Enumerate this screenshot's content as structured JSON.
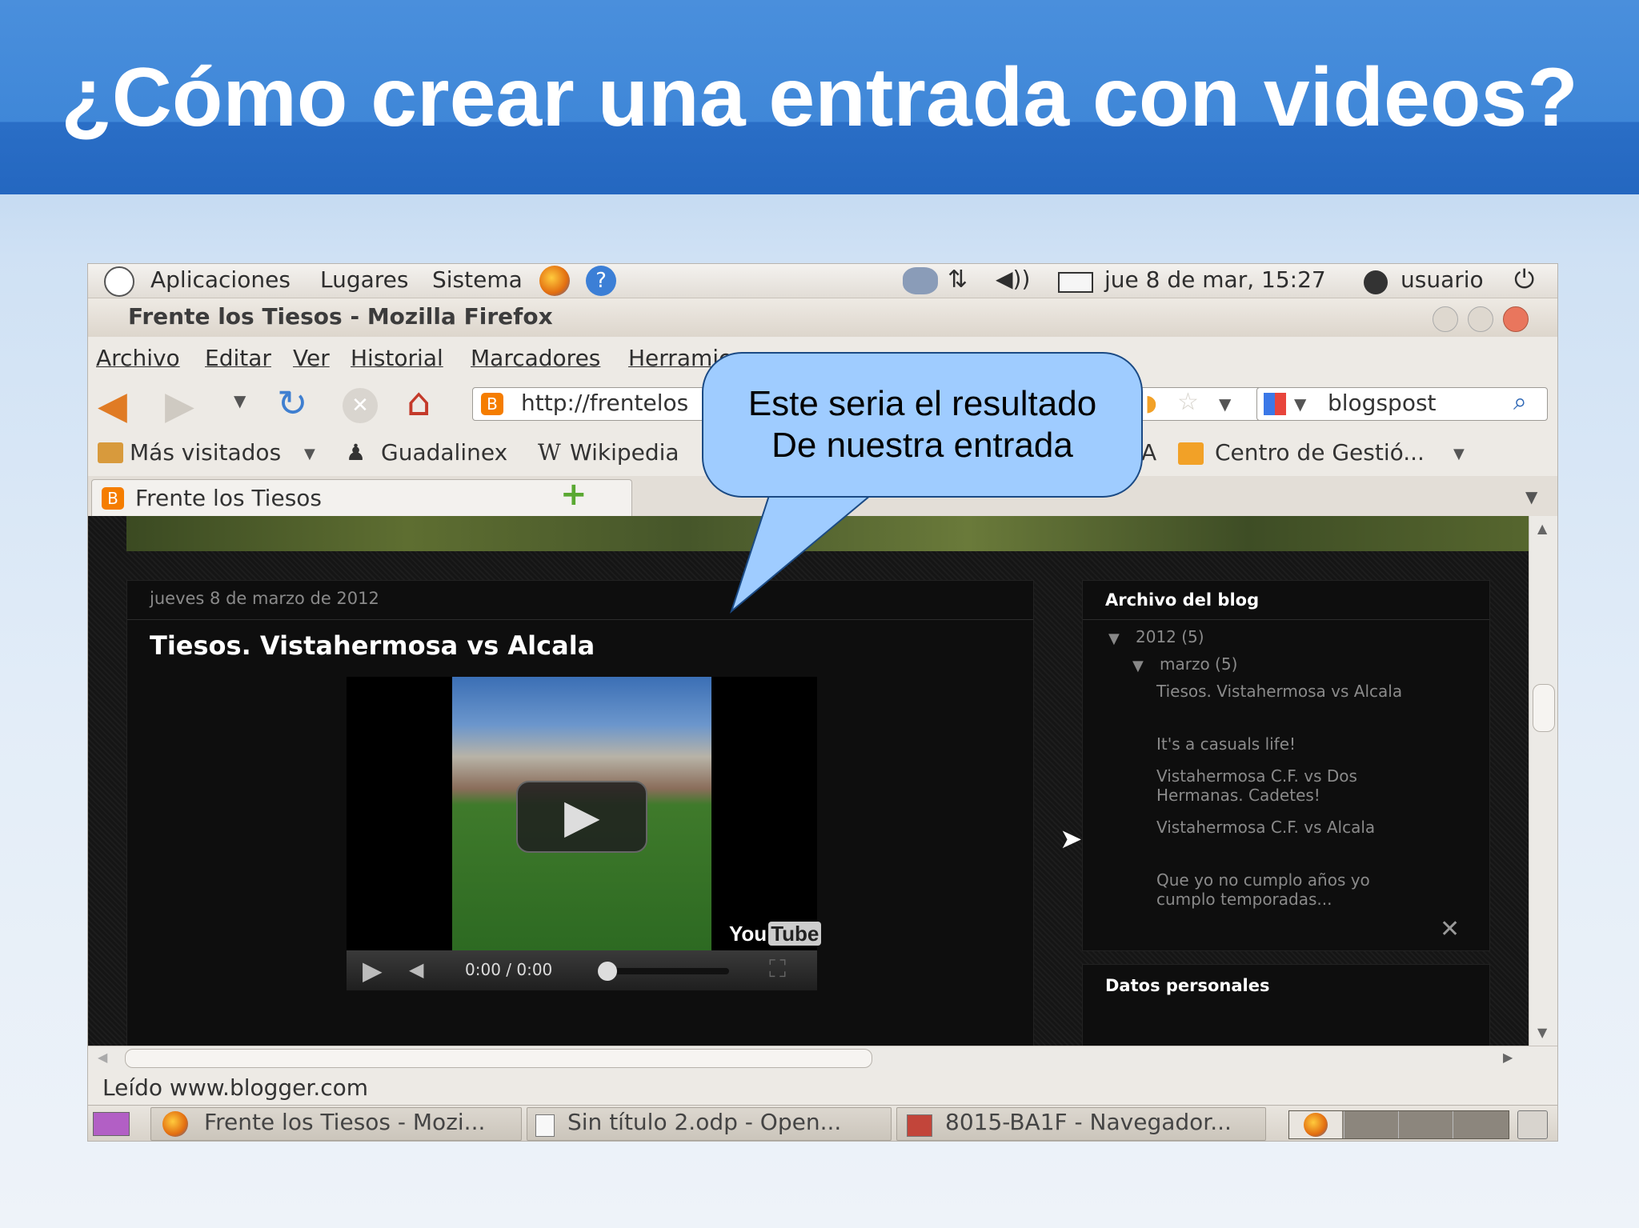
{
  "slide": {
    "title": "¿Cómo crear una entrada con videos?"
  },
  "callout": {
    "line1": "Este seria el resultado",
    "line2": "De nuestra entrada"
  },
  "gnome_panel": {
    "menus": [
      "Aplicaciones",
      "Lugares",
      "Sistema"
    ],
    "clock": "jue  8 de mar, 15:27",
    "user": "usuario"
  },
  "window": {
    "title": "Frente los Tiesos - Mozilla Firefox"
  },
  "menubar": [
    "Archivo",
    "Editar",
    "Ver",
    "Historial",
    "Marcadores",
    "Herramie"
  ],
  "navbar": {
    "url": "http://frentelos",
    "search_value": "blogspost"
  },
  "bookmarks": {
    "items": [
      "Más visitados",
      "Guadalinex",
      "Wikipedia"
    ],
    "partial": "A",
    "right_item": "Centro de Gestió..."
  },
  "tabs": [
    {
      "label": "Frente los Tiesos"
    }
  ],
  "post": {
    "date": "jueves 8 de marzo de 2012",
    "title": "Tiesos. Vistahermosa vs Alcala",
    "video": {
      "time": "0:00 / 0:00",
      "brand_you": "You",
      "brand_tube": "Tube"
    }
  },
  "sidebar": {
    "archive_title": "Archivo del blog",
    "year": "2012 (5)",
    "month": "marzo (5)",
    "posts": [
      "Tiesos. Vistahermosa vs Alcala",
      "It's a casuals life!",
      "Vistahermosa C.F. vs Dos Hermanas. Cadetes!",
      "Vistahermosa C.F. vs Alcala",
      "Que yo no cumplo años yo cumplo temporadas..."
    ],
    "personal_title": "Datos personales"
  },
  "status": {
    "text": "Leído www.blogger.com"
  },
  "taskbar": {
    "items": [
      "Frente los Tiesos - Mozi...",
      "Sin título 2.odp - Open...",
      "8015-BA1F - Navegador..."
    ]
  },
  "colors": {
    "title_bar": "#3f87d8",
    "callout_fill": "#9fccff",
    "callout_border": "#1b4a84",
    "blog_background": "#181818"
  }
}
